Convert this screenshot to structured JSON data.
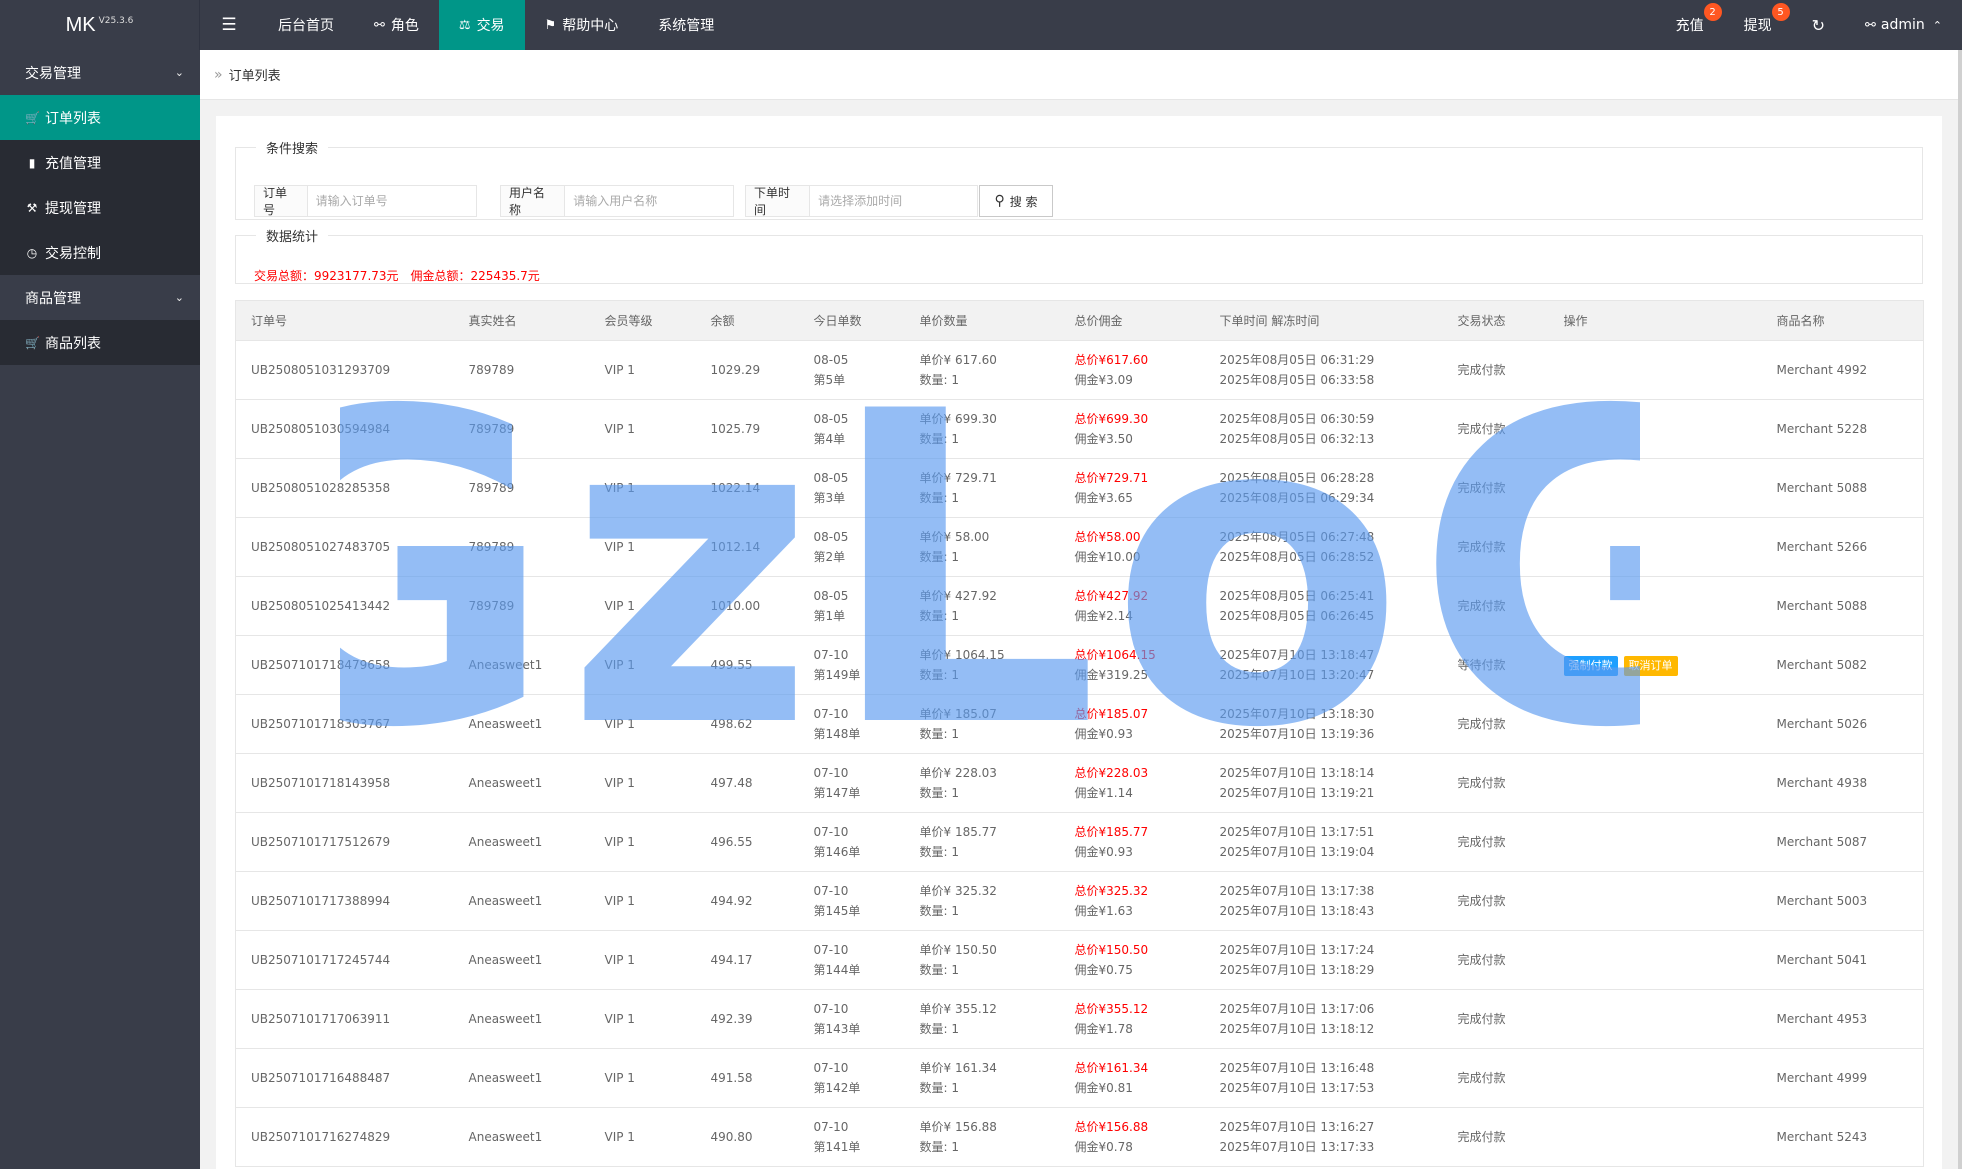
{
  "app": {
    "logo": "MK",
    "version": "V25.3.6"
  },
  "topnav": {
    "items": [
      {
        "label": "后台首页",
        "icon": ""
      },
      {
        "label": "角色",
        "icon": "user-icon"
      },
      {
        "label": "交易",
        "icon": "scale-icon"
      },
      {
        "label": "帮助中心",
        "icon": "flag-icon"
      },
      {
        "label": "系统管理",
        "icon": ""
      }
    ],
    "recharge_label": "充值",
    "recharge_badge": "2",
    "withdraw_label": "提现",
    "withdraw_badge": "5",
    "user_label": "admin"
  },
  "sidebar": {
    "groups": [
      {
        "label": "交易管理",
        "items": [
          "订单列表",
          "充值管理",
          "提现管理",
          "交易控制"
        ]
      },
      {
        "label": "商品管理",
        "items": [
          "商品列表"
        ]
      }
    ]
  },
  "breadcrumb": {
    "current": "订单列表"
  },
  "search": {
    "legend": "条件搜索",
    "order_label": "订单号",
    "order_placeholder": "请输入订单号",
    "user_label": "用户名称",
    "user_placeholder": "请输入用户名称",
    "time_label": "下单时间",
    "time_placeholder": "请选择添加时间",
    "button": "搜 索"
  },
  "stats": {
    "legend": "数据统计",
    "trade_total": "交易总额：9923177.73元",
    "commission_total": "佣金总额：225435.7元"
  },
  "table": {
    "headers": [
      "订单号",
      "真实姓名",
      "会员等级",
      "余额",
      "今日单数",
      "单价数量",
      "总价佣金",
      "下单时间 解冻时间",
      "交易状态",
      "操作",
      "商品名称"
    ],
    "rows": [
      {
        "order": "UB2508051031293709",
        "name": "789789",
        "level": "VIP 1",
        "balance": "1029.29",
        "date": "08-05",
        "nth": "第5单",
        "price": "单价¥  617.60",
        "qty": "数量:  1",
        "total": "总价¥617.60",
        "commission": "佣金¥3.09",
        "ordered": "2025年08月05日 06:31:29",
        "unfrozen": "2025年08月05日 06:33:58",
        "status": "完成付款",
        "ops": [],
        "product": "Merchant 4992"
      },
      {
        "order": "UB2508051030594984",
        "name": "789789",
        "level": "VIP 1",
        "balance": "1025.79",
        "date": "08-05",
        "nth": "第4单",
        "price": "单价¥  699.30",
        "qty": "数量:  1",
        "total": "总价¥699.30",
        "commission": "佣金¥3.50",
        "ordered": "2025年08月05日 06:30:59",
        "unfrozen": "2025年08月05日 06:32:13",
        "status": "完成付款",
        "ops": [],
        "product": "Merchant 5228"
      },
      {
        "order": "UB2508051028285358",
        "name": "789789",
        "level": "VIP 1",
        "balance": "1022.14",
        "date": "08-05",
        "nth": "第3单",
        "price": "单价¥  729.71",
        "qty": "数量:  1",
        "total": "总价¥729.71",
        "commission": "佣金¥3.65",
        "ordered": "2025年08月05日 06:28:28",
        "unfrozen": "2025年08月05日 06:29:34",
        "status": "完成付款",
        "ops": [],
        "product": "Merchant 5088"
      },
      {
        "order": "UB2508051027483705",
        "name": "789789",
        "level": "VIP 1",
        "balance": "1012.14",
        "date": "08-05",
        "nth": "第2单",
        "price": "单价¥  58.00",
        "qty": "数量:  1",
        "total": "总价¥58.00",
        "commission": "佣金¥10.00",
        "ordered": "2025年08月05日 06:27:48",
        "unfrozen": "2025年08月05日 06:28:52",
        "status": "完成付款",
        "ops": [],
        "product": "Merchant 5266"
      },
      {
        "order": "UB2508051025413442",
        "name": "789789",
        "level": "VIP 1",
        "balance": "1010.00",
        "date": "08-05",
        "nth": "第1单",
        "price": "单价¥  427.92",
        "qty": "数量:  1",
        "total": "总价¥427.92",
        "commission": "佣金¥2.14",
        "ordered": "2025年08月05日 06:25:41",
        "unfrozen": "2025年08月05日 06:26:45",
        "status": "完成付款",
        "ops": [],
        "product": "Merchant 5088"
      },
      {
        "order": "UB2507101718479658",
        "name": "Aneasweet1",
        "level": "VIP 1",
        "balance": "499.55",
        "date": "07-10",
        "nth": "第149单",
        "price": "单价¥  1064.15",
        "qty": "数量:  1",
        "total": "总价¥1064.15",
        "commission": "佣金¥319.25",
        "ordered": "2025年07月10日 13:18:47",
        "unfrozen": "2025年07月10日 13:20:47",
        "status": "等待付款",
        "ops": [
          {
            "label": "强制付款",
            "color": "#1e9fff"
          },
          {
            "label": "取消订单",
            "color": "#ffb800"
          }
        ],
        "product": "Merchant 5082"
      },
      {
        "order": "UB2507101718303767",
        "name": "Aneasweet1",
        "level": "VIP 1",
        "balance": "498.62",
        "date": "07-10",
        "nth": "第148单",
        "price": "单价¥  185.07",
        "qty": "数量:  1",
        "total": "总价¥185.07",
        "commission": "佣金¥0.93",
        "ordered": "2025年07月10日 13:18:30",
        "unfrozen": "2025年07月10日 13:19:36",
        "status": "完成付款",
        "ops": [],
        "product": "Merchant 5026"
      },
      {
        "order": "UB2507101718143958",
        "name": "Aneasweet1",
        "level": "VIP 1",
        "balance": "497.48",
        "date": "07-10",
        "nth": "第147单",
        "price": "单价¥  228.03",
        "qty": "数量:  1",
        "total": "总价¥228.03",
        "commission": "佣金¥1.14",
        "ordered": "2025年07月10日 13:18:14",
        "unfrozen": "2025年07月10日 13:19:21",
        "status": "完成付款",
        "ops": [],
        "product": "Merchant 4938"
      },
      {
        "order": "UB2507101717512679",
        "name": "Aneasweet1",
        "level": "VIP 1",
        "balance": "496.55",
        "date": "07-10",
        "nth": "第146单",
        "price": "单价¥  185.77",
        "qty": "数量:  1",
        "total": "总价¥185.77",
        "commission": "佣金¥0.93",
        "ordered": "2025年07月10日 13:17:51",
        "unfrozen": "2025年07月10日 13:19:04",
        "status": "完成付款",
        "ops": [],
        "product": "Merchant 5087"
      },
      {
        "order": "UB2507101717388994",
        "name": "Aneasweet1",
        "level": "VIP 1",
        "balance": "494.92",
        "date": "07-10",
        "nth": "第145单",
        "price": "单价¥  325.32",
        "qty": "数量:  1",
        "total": "总价¥325.32",
        "commission": "佣金¥1.63",
        "ordered": "2025年07月10日 13:17:38",
        "unfrozen": "2025年07月10日 13:18:43",
        "status": "完成付款",
        "ops": [],
        "product": "Merchant 5003"
      },
      {
        "order": "UB2507101717245744",
        "name": "Aneasweet1",
        "level": "VIP 1",
        "balance": "494.17",
        "date": "07-10",
        "nth": "第144单",
        "price": "单价¥  150.50",
        "qty": "数量:  1",
        "total": "总价¥150.50",
        "commission": "佣金¥0.75",
        "ordered": "2025年07月10日 13:17:24",
        "unfrozen": "2025年07月10日 13:18:29",
        "status": "完成付款",
        "ops": [],
        "product": "Merchant 5041"
      },
      {
        "order": "UB2507101717063911",
        "name": "Aneasweet1",
        "level": "VIP 1",
        "balance": "492.39",
        "date": "07-10",
        "nth": "第143单",
        "price": "单价¥  355.12",
        "qty": "数量:  1",
        "total": "总价¥355.12",
        "commission": "佣金¥1.78",
        "ordered": "2025年07月10日 13:17:06",
        "unfrozen": "2025年07月10日 13:18:12",
        "status": "完成付款",
        "ops": [],
        "product": "Merchant 4953"
      },
      {
        "order": "UB2507101716488487",
        "name": "Aneasweet1",
        "level": "VIP 1",
        "balance": "491.58",
        "date": "07-10",
        "nth": "第142单",
        "price": "单价¥  161.34",
        "qty": "数量:  1",
        "total": "总价¥161.34",
        "commission": "佣金¥0.81",
        "ordered": "2025年07月10日 13:16:48",
        "unfrozen": "2025年07月10日 13:17:53",
        "status": "完成付款",
        "ops": [],
        "product": "Merchant 4999"
      },
      {
        "order": "UB2507101716274829",
        "name": "Aneasweet1",
        "level": "VIP 1",
        "balance": "490.80",
        "date": "07-10",
        "nth": "第141单",
        "price": "单价¥  156.88",
        "qty": "数量:  1",
        "total": "总价¥156.88",
        "commission": "佣金¥0.78",
        "ordered": "2025年07月10日 13:16:27",
        "unfrozen": "2025年07月10日 13:17:33",
        "status": "完成付款",
        "ops": [],
        "product": "Merchant 5243"
      }
    ]
  },
  "watermark": {
    "text": "GzLoG",
    "color": "#5b9bf0"
  }
}
